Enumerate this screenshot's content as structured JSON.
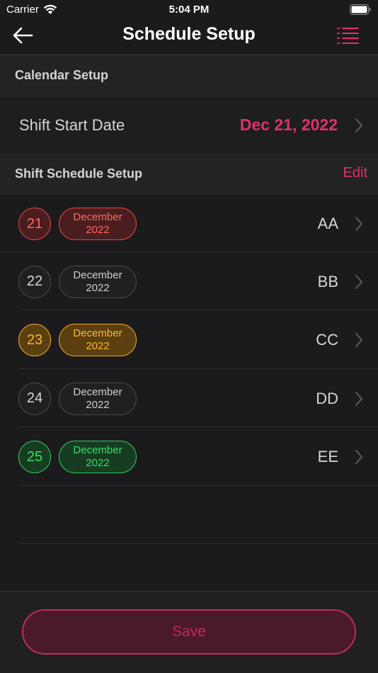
{
  "status_bar": {
    "carrier": "Carrier",
    "time": "5:04 PM"
  },
  "nav": {
    "title": "Schedule Setup",
    "back_icon": "arrow-left-icon",
    "menu_icon": "list-icon"
  },
  "calendar_section": {
    "header": "Calendar Setup",
    "shift_start_label": "Shift Start Date",
    "shift_start_value": "Dec 21, 2022"
  },
  "schedule_section": {
    "header": "Shift Schedule Setup",
    "edit_label": "Edit",
    "rows": [
      {
        "day": "21",
        "month": "December",
        "year": "2022",
        "code": "AA",
        "color": "red"
      },
      {
        "day": "22",
        "month": "December",
        "year": "2022",
        "code": "BB",
        "color": "gray"
      },
      {
        "day": "23",
        "month": "December",
        "year": "2022",
        "code": "CC",
        "color": "orange"
      },
      {
        "day": "24",
        "month": "December",
        "year": "2022",
        "code": "DD",
        "color": "gray"
      },
      {
        "day": "25",
        "month": "December",
        "year": "2022",
        "code": "EE",
        "color": "green"
      }
    ]
  },
  "footer": {
    "save_label": "Save"
  },
  "colors": {
    "accent": "#e0306f",
    "red": "#e8453c",
    "orange": "#f5a623",
    "green": "#34c759",
    "background": "#1b1b1d"
  }
}
